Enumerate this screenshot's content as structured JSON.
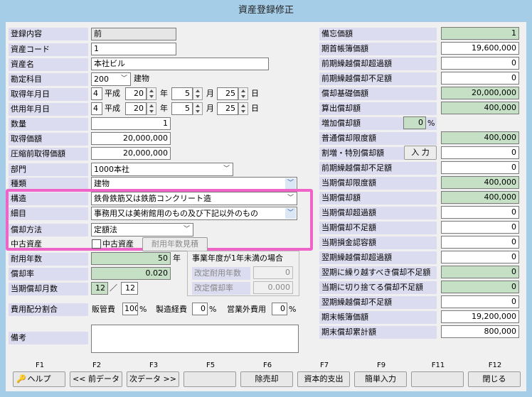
{
  "window": {
    "title": "資産登録修正"
  },
  "left": {
    "touroku": {
      "label": "登録内容",
      "value": "前"
    },
    "code": {
      "label": "資産コード",
      "value": "1"
    },
    "name": {
      "label": "資産名",
      "value": "本社ビル"
    },
    "kanjo": {
      "label": "勘定科目",
      "code": "200",
      "name": "建物"
    },
    "shutoku": {
      "label": "取得年月日",
      "era_code": "4",
      "era": "平成",
      "year": "20",
      "year_unit": "年",
      "month": "5",
      "month_unit": "月",
      "day": "25",
      "day_unit": "日"
    },
    "kyoyo": {
      "label": "供用年月日",
      "era_code": "4",
      "era": "平成",
      "year": "20",
      "year_unit": "年",
      "month": "5",
      "month_unit": "月",
      "day": "25",
      "day_unit": "日"
    },
    "suryo": {
      "label": "数量",
      "value": "1"
    },
    "kagaku": {
      "label": "取得価額",
      "value": "20,000,000"
    },
    "asshuku": {
      "label": "圧縮前取得価額",
      "value": "20,000,000"
    },
    "bumon": {
      "label": "部門",
      "value": "1000本社"
    },
    "shurui": {
      "label": "種類",
      "value": "建物"
    },
    "kozo": {
      "label": "構造",
      "value": "鉄骨鉄筋又は鉄筋コンクリート造"
    },
    "saimoku": {
      "label": "細目",
      "value": "事務用又は美術館用のもの及び下記以外のもの"
    },
    "hoho": {
      "label": "償却方法",
      "value": "定額法"
    },
    "chuko": {
      "label": "中古資産",
      "check_label": "中古資産",
      "button": "耐用年数見積"
    },
    "taiyo": {
      "label": "耐用年数",
      "value": "50",
      "unit": "年"
    },
    "ritsu": {
      "label": "償却率",
      "value": "0.020"
    },
    "tsuki": {
      "label": "当期償却月数",
      "value1": "12",
      "sep": "／",
      "value2": "12"
    },
    "jigyo": {
      "title": "事業年度が1年未満の場合",
      "kaitei_nensu": "改定耐用年数",
      "kaitei_nensu_value": "0",
      "kaitei_ritsu": "改定償却率",
      "kaitei_ritsu_value": "0.000"
    },
    "haibun": {
      "label": "費用配分割合",
      "hankan": "販管費",
      "hankan_value": "100",
      "seizo": "製造経費",
      "seizo_value": "0",
      "eigyogai": "営業外費用",
      "eigyogai_value": "0",
      "pct": "%"
    },
    "biko": {
      "label": "備考",
      "value": ""
    }
  },
  "right": {
    "rows": [
      {
        "label": "備忘価額",
        "value": "1",
        "style": "g"
      },
      {
        "label": "期首帳簿価額",
        "value": "19,600,000",
        "style": "w"
      },
      {
        "label": "前期繰越償却超過額",
        "value": "0",
        "style": "w"
      },
      {
        "label": "前期繰越償却不足額",
        "value": "0",
        "style": "w"
      },
      {
        "label": "償却基礎価額",
        "value": "20,000,000",
        "style": "g"
      },
      {
        "label": "算出償却額",
        "value": "400,000",
        "style": "g"
      },
      {
        "label": "増加償却額",
        "value": "0",
        "style": "pct"
      },
      {
        "label": "普通償却限度額",
        "value": "400,000",
        "style": "g"
      },
      {
        "label": "割増・特別償却額",
        "value": "0",
        "style": "btn"
      },
      {
        "label": "前期繰越償却不足額",
        "value": "0",
        "style": "w"
      },
      {
        "label": "当期償却限度額",
        "value": "400,000",
        "style": "g"
      },
      {
        "label": "当期償却額",
        "value": "400,000",
        "style": "g"
      },
      {
        "label": "当期償却超過額",
        "value": "0",
        "style": "w"
      },
      {
        "label": "当期償却不足額",
        "value": "0",
        "style": "w"
      },
      {
        "label": "当期損金認容額",
        "value": "0",
        "style": "w"
      },
      {
        "label": "翌期繰越償却超過額",
        "value": "0",
        "style": "w"
      },
      {
        "label": "翌期に繰り越すべき償却不足額",
        "value": "0",
        "style": "g"
      },
      {
        "label": "当期に切り捨てる償却不足額",
        "value": "0",
        "style": "g"
      },
      {
        "label": "翌期繰越償却不足額",
        "value": "0",
        "style": "w"
      },
      {
        "label": "期末帳簿価額",
        "value": "19,200,000",
        "style": "w"
      },
      {
        "label": "期末償却累計額",
        "value": "800,000",
        "style": "w"
      }
    ],
    "zoka_pct": "%",
    "input_button": "入 力"
  },
  "fkeys": [
    {
      "key": "F1",
      "label": "ヘルプ"
    },
    {
      "key": "F2",
      "label": "<< 前データ"
    },
    {
      "key": "F3",
      "label": "次データ >>"
    },
    {
      "key": "F5",
      "label": ""
    },
    {
      "key": "F6",
      "label": "除売却"
    },
    {
      "key": "F7",
      "label": "資本的支出"
    },
    {
      "key": "F9",
      "label": "簡単入力"
    },
    {
      "key": "F11",
      "label": ""
    },
    {
      "key": "F12",
      "label": "閉じる"
    }
  ],
  "colors": {
    "label_bg": "#dcdcf0",
    "green_field": "#c6e0c6",
    "highlight": "#f064c8",
    "frame": "#a6cde8"
  }
}
